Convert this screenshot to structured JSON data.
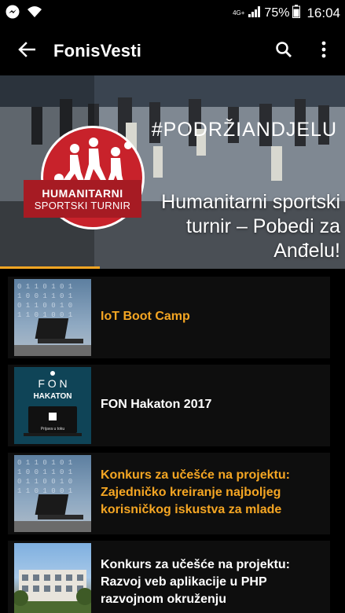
{
  "status_bar": {
    "network": "4G+",
    "battery": "75%",
    "time": "16:04",
    "icons": [
      "messenger-icon",
      "wifi-icon",
      "signal-icon",
      "battery-icon"
    ]
  },
  "app_bar": {
    "title": "FonisVesti",
    "icons": [
      "arrow-left-icon",
      "search-icon",
      "more-vert-icon"
    ]
  },
  "hero": {
    "hashtag": "#PODRŽIANDJELU",
    "logo_line1": "HUMANITARNI",
    "logo_line2": "SPORTSKI TURNIR",
    "title": "Humanitarni sportski turnir – Pobedi za Anđelu!",
    "progress": 0.29
  },
  "colors": {
    "accent": "#f5a623",
    "logo_red": "#c8222b",
    "card_bg": "#0e0e0e"
  },
  "news": [
    {
      "title": "IoT Boot Camp",
      "thumb": "binary-laptop"
    },
    {
      "title": "FON Hakaton 2017",
      "thumb": "fon-hakaton",
      "thumb_text_1": "F O N",
      "thumb_text_2": "HAKATON",
      "thumb_text_3": "Prijava u toku"
    },
    {
      "title": "Konkurs za učešće na projektu: Zajedničko kreiranje najboljeg korisničkog iskustva za mlade",
      "thumb": "binary-laptop"
    },
    {
      "title": "Konkurs za učešće na projektu: Razvoj veb aplikacije u PHP razvojnom okruženju",
      "thumb": "campus-building"
    }
  ]
}
